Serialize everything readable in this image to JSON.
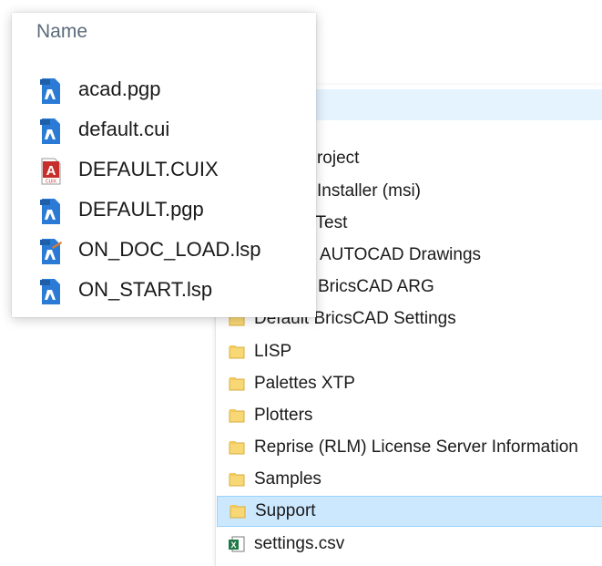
{
  "explorer_list": {
    "items": [
      {
        "label": "",
        "icon": "folder-icon",
        "state": "hover"
      },
      {
        "label": "sk Project",
        "icon": "folder-icon"
      },
      {
        "label": "D Installer (msi)",
        "icon": "folder-icon"
      },
      {
        "label": "d Test",
        "icon": "folder-icon"
      },
      {
        "label": "AUTOCAD Drawings",
        "icon": "folder-icon"
      },
      {
        "label": "BricsCAD ARG",
        "icon": "folder-icon"
      },
      {
        "label": "Default BricsCAD Settings",
        "icon": "folder-icon"
      },
      {
        "label": "LISP",
        "icon": "folder-icon"
      },
      {
        "label": "Palettes XTP",
        "icon": "folder-icon"
      },
      {
        "label": "Plotters",
        "icon": "folder-icon"
      },
      {
        "label": "Reprise (RLM) License Server Information",
        "icon": "folder-icon"
      },
      {
        "label": "Samples",
        "icon": "folder-icon"
      },
      {
        "label": "Support",
        "icon": "folder-icon",
        "state": "selected"
      },
      {
        "label": "settings.csv",
        "icon": "excel-file-icon"
      }
    ]
  },
  "popup": {
    "header": "Name",
    "files": [
      {
        "label": "acad.pgp",
        "icon": "pgp-file-icon"
      },
      {
        "label": "default.cui",
        "icon": "cui-file-icon"
      },
      {
        "label": "DEFAULT.CUIX",
        "icon": "cuix-file-icon"
      },
      {
        "label": "DEFAULT.pgp",
        "icon": "pgp-file-icon"
      },
      {
        "label": "ON_DOC_LOAD.lsp",
        "icon": "lsp-file-icon"
      },
      {
        "label": "ON_START.lsp",
        "icon": "lsp-file-icon"
      }
    ]
  },
  "colors": {
    "selection": "#cce8ff",
    "hover": "#e5f3ff",
    "folder": "#f8d775",
    "file_blue": "#2b7bd6",
    "cuix_red": "#c62f2b",
    "excel_green": "#1f7a46"
  }
}
